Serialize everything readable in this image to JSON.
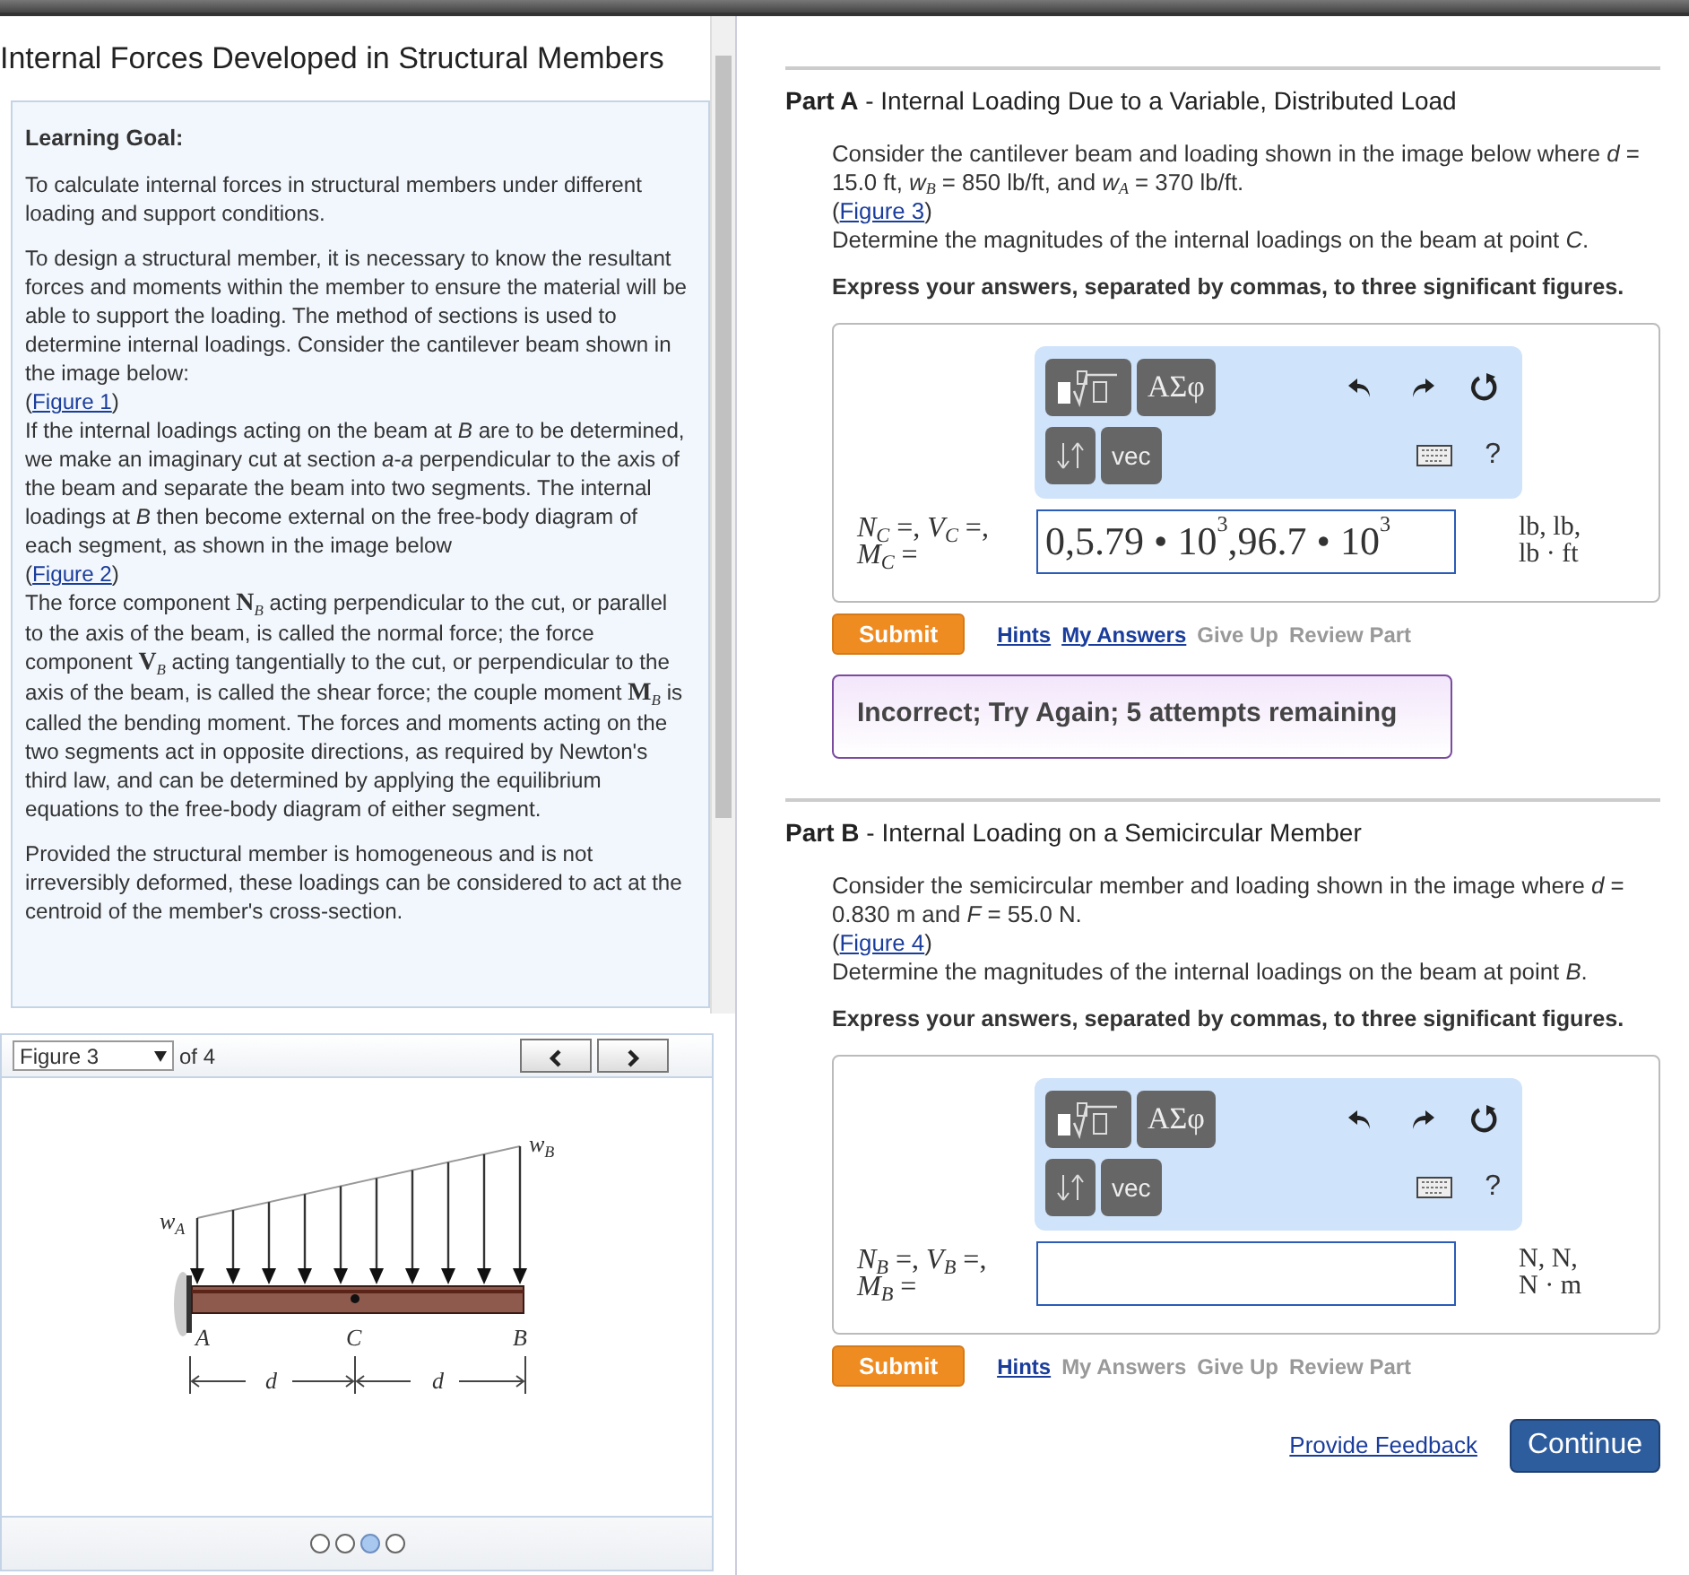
{
  "title": "Internal Forces Developed in Structural Members",
  "learning_goal": {
    "heading": "Learning Goal:",
    "paragraphs": [
      [
        {
          "kind": "text",
          "text": "To calculate internal forces in structural members under different loading and support conditions."
        }
      ],
      [
        {
          "kind": "text",
          "text": "To design a structural member, it is necessary to know the resultant forces and moments within the member to ensure the material will be able to support the loading. The method of sections is used to determine internal loadings. Consider the cantilever beam shown in the image below:"
        },
        {
          "kind": "figure_link",
          "before": "(",
          "label": "Figure 1",
          "after": ")"
        },
        {
          "kind": "text",
          "text": "If the internal loadings acting on the beam at *B* are to be determined, we make an imaginary cut at section *a*-*a* perpendicular to the axis of the beam and separate the beam into two segments. The internal loadings at *B* then become external on the free-body diagram of each segment, as shown in the image below"
        },
        {
          "kind": "figure_link",
          "before": "(",
          "label": "Figure 2",
          "after": ")"
        },
        {
          "kind": "text",
          "text": "The force component **N**$_{B}$ acting perpendicular to the cut, or parallel to the axis of the beam, is called the normal force; the force component **V**$_{B}$ acting tangentially to the cut, or perpendicular to the axis of the beam, is called the shear force; the couple moment **M**$_{B}$ is called the bending moment. The forces and moments acting on the two segments act in opposite directions, as required by Newton's third law, and can be determined by applying the equilibrium equations to the free-body diagram of either segment."
        }
      ],
      [
        {
          "kind": "text",
          "text": "Provided the structural member is homogeneous and is not irreversibly deformed, these loadings can be considered to act at the centroid of the member's cross-section."
        }
      ]
    ]
  },
  "figure_panel": {
    "selector": "Figure 3",
    "count": "of 4",
    "labels": {
      "w_a": "w",
      "w_a_sub": "A",
      "w_b": "w",
      "w_b_sub": "B",
      "a": "A",
      "c": "C",
      "b": "B",
      "d_left": "d",
      "d_right": "d"
    },
    "pager": [
      {
        "selected": false
      },
      {
        "selected": false
      },
      {
        "selected": true
      },
      {
        "selected": false
      }
    ]
  },
  "parts": [
    {
      "label": "Part A",
      "separator": "-",
      "title": "Internal Loading Due to a Variable, Distributed Load",
      "statement": "Consider the cantilever beam and loading shown in the image below where *d* = 15.0 ft, *w*$_{B}$ = 850 lb/ft, and *w*$_{A}$ = 370 lb/ft.",
      "figure_link": {
        "before": "(",
        "label": "Figure 3",
        "after": ")"
      },
      "question": "Determine the magnitudes of the internal loadings on the beam at point *C*.",
      "instruction": "Express your answers, separated by commas, to three significant figures.",
      "toolbar": {
        "symbols": "ΑΣφ",
        "vector": "vec",
        "help": "?"
      },
      "answer_label": "*N*$_{C}$ =, *V*$_{C}$ =, *M*$_{C}$ =",
      "answer_value": "0,5.79 • 10$^{3}$,96.7 • 10$^{3}$",
      "units": "lb, lb, lb · ft",
      "submit": "Submit",
      "links": [
        {
          "label": "Hints",
          "disabled": false
        },
        {
          "label": "My Answers",
          "disabled": false
        },
        {
          "label": "Give Up",
          "disabled": true
        },
        {
          "label": "Review Part",
          "disabled": true
        }
      ],
      "feedback": {
        "kind": "incorrect",
        "text": "Incorrect; Try Again; 5 attempts remaining"
      }
    },
    {
      "label": "Part B",
      "separator": "-",
      "title": "Internal Loading on a Semicircular Member",
      "statement": "Consider the semicircular member and loading shown in the image where *d* = 0.830 m and *F* = 55.0 N.",
      "figure_link": {
        "before": "(",
        "label": "Figure 4",
        "after": ")"
      },
      "question": "Determine the magnitudes of the internal loadings on the beam at point *B*.",
      "instruction": "Express your answers, separated by commas, to three significant figures.",
      "toolbar": {
        "symbols": "ΑΣφ",
        "vector": "vec",
        "help": "?"
      },
      "answer_label": "*N*$_{B}$ =, *V*$_{B}$ =, *M*$_{B}$ =",
      "units": "N, N, N · m",
      "submit": "Submit",
      "links": [
        {
          "label": "Hints",
          "disabled": false
        },
        {
          "label": "My Answers",
          "disabled": true
        },
        {
          "label": "Give Up",
          "disabled": true
        },
        {
          "label": "Review Part",
          "disabled": true
        }
      ]
    }
  ],
  "footer": {
    "feedback_link": "Provide Feedback",
    "continue": "Continue"
  }
}
